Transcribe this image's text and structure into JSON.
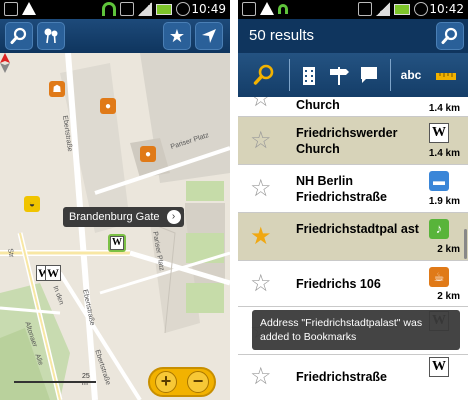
{
  "status_left": {
    "time": "10:49"
  },
  "status_right": {
    "time": "10:42"
  },
  "map": {
    "callout_label": "Brandenburg Gate",
    "callout_arrow": "›",
    "street_ebertstrasse_top": "Ebertstraße",
    "street_ebertstrasse_mid": "Ebertstraße",
    "street_ebertstrasse_low": "Ebertstraße",
    "street_pariser_platz_1": "Pariser Platz",
    "street_pariser_platz_2": "Pariser Platz",
    "street_altonaer": "Altonaer",
    "street_in_den": "In den",
    "street_str": "Str",
    "street_alle": "Alle",
    "scale_label": "25 m",
    "zoom_in": "+",
    "zoom_out": "−",
    "wiki_glyph": "W"
  },
  "results": {
    "title": "50 results",
    "sort_alpha": "abc",
    "items": [
      {
        "name": "Church",
        "distance": "1.4 km",
        "favorite": false,
        "selected": false,
        "category": "wiki-icon"
      },
      {
        "name": "Friedrichswerder Church",
        "distance": "1.4 km",
        "favorite": false,
        "selected": true,
        "category": "wiki-icon"
      },
      {
        "name": "NH Berlin Friedrichstraße",
        "distance": "1.9 km",
        "favorite": false,
        "selected": false,
        "category": "hotel-icon"
      },
      {
        "name": "Friedrichstadtpal ast",
        "distance": "2 km",
        "favorite": true,
        "selected": true,
        "category": "theater-icon"
      },
      {
        "name": "Friedrichs 106",
        "distance": "2 km",
        "favorite": false,
        "selected": false,
        "category": "cafe-icon"
      },
      {
        "name": "Friedrichstraße",
        "distance": "",
        "favorite": false,
        "selected": false,
        "category": "wiki-icon"
      }
    ],
    "wiki_glyph": "W",
    "toast": "Address \"Friedrichstadtpalast\" was added to Bookmarks"
  },
  "colors": {
    "toolbar": "#0f355e",
    "accent_yellow": "#f2b200",
    "selected_row": "#d7d3b9",
    "favorite_star": "#f0a812"
  }
}
